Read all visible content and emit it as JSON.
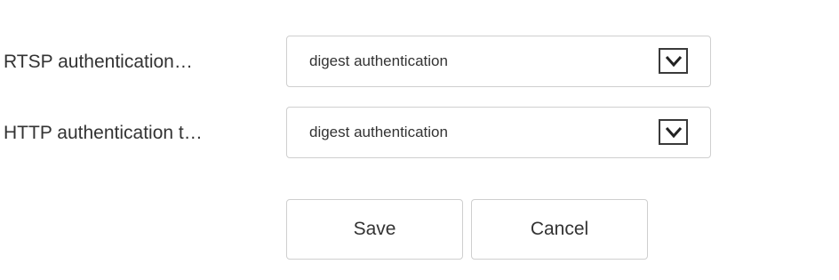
{
  "form": {
    "rtsp": {
      "label": "RTSP authentication…",
      "value": "digest authentication",
      "icon": "chevron-down-icon"
    },
    "http": {
      "label": "HTTP authentication t…",
      "value": "digest authentication",
      "icon": "chevron-down-icon"
    }
  },
  "actions": {
    "save_label": "Save",
    "cancel_label": "Cancel"
  }
}
